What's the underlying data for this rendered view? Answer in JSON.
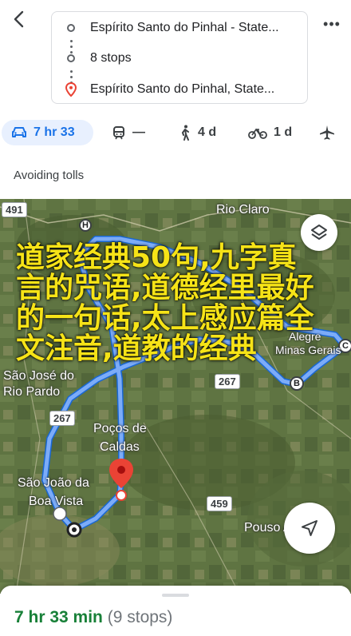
{
  "header": {
    "origin": "Espírito Santo do Pinhal - State...",
    "stops": "8 stops",
    "destination": "Espírito Santo do Pinhal, State..."
  },
  "modes": {
    "car": "7 hr 33",
    "transit": "—",
    "walk": "4 d",
    "bike": "1 d"
  },
  "notice": "Avoiding tolls",
  "map": {
    "places": {
      "rio_claro": "Rio Claro",
      "sao_jose": "São José do",
      "rio_pardo": "Rio Pardo",
      "pocos_de": "Poços de",
      "caldas": "Caldas",
      "sao_joao": "São João da",
      "boa_vista": "Boa Vista",
      "alegre": "Alegre",
      "minas_gerais": "Minas Gerais",
      "pouso_alegre": "Pouso Alegre"
    },
    "shields": {
      "r491": "491",
      "r267a": "267",
      "r267b": "267",
      "r459": "459"
    },
    "markers": {
      "h": "H",
      "b": "B",
      "c": "C"
    },
    "overlay": "道家经典50句,九字真言的咒语,道德经里最好的一句话,太上感应篇全文注音,道教的经典"
  },
  "sheet": {
    "duration": "7 hr 33 min",
    "stops": "(9 stops)"
  },
  "colors": {
    "accent": "#1a73e8",
    "route": "#669df6",
    "duration": "#188038",
    "pin": "#ea4335"
  }
}
